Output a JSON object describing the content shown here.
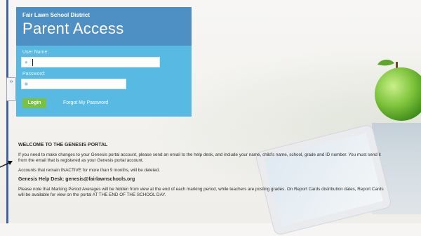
{
  "header": {
    "district": "Fair Lawn School District",
    "title": "Parent Access"
  },
  "login": {
    "username_label": "User Name:",
    "username_value": "",
    "password_label": "Password:",
    "password_value": "",
    "login_button": "Login",
    "forgot_link": "Forgot My Password",
    "user_icon": "user-icon",
    "lock_icon": "lock-icon"
  },
  "rail": {
    "handle_icon": "expand-handle-icon",
    "handle_glyph": "››"
  },
  "welcome": {
    "heading": "WELCOME TO THE GENESIS PORTAL",
    "para1": "If you need to make changes to your Genesis portal account, please send an email to the help desk, and include your name, child's name, school, grade and ID number. You must send it from the email that is registered as your Genesis portal account.",
    "para2": "Accounts that remain INACTIVE for more than 9 months, will be deleted.",
    "helpdesk": "Genesis Help Desk: genesis@fairlawnschools.org",
    "para3": "Please note that Marking Period Averages will be hidden from view at the end of each marking period, while teachers are posting grades. On Report Cards distribution dates, Report Cards will be available for view on the portal AT THE END OF THE SCHOOL DAY."
  },
  "colors": {
    "header_blue": "#4f90c4",
    "panel_blue": "#58b9e3",
    "login_green": "#7ac143",
    "rail_blue": "#3c63a6"
  }
}
